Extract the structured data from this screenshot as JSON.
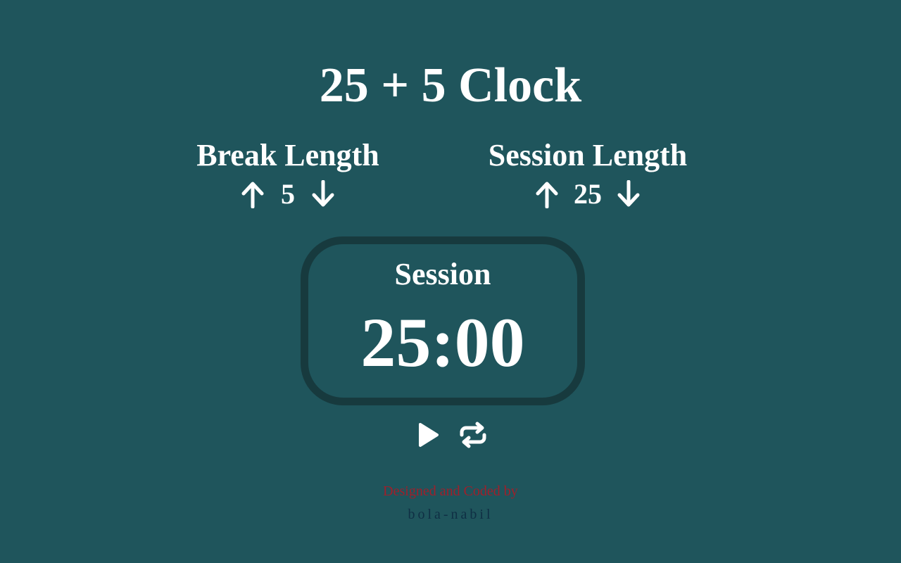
{
  "app": {
    "title": "25 + 5 Clock"
  },
  "break": {
    "label": "Break Length",
    "value": "5",
    "increment_icon": "arrow-up-icon",
    "decrement_icon": "arrow-down-icon"
  },
  "session": {
    "label": "Session Length",
    "value": "25",
    "increment_icon": "arrow-up-icon",
    "decrement_icon": "arrow-down-icon"
  },
  "timer": {
    "label": "Session",
    "time": "25:00"
  },
  "controls": {
    "play_icon": "play-icon",
    "reset_icon": "repeat-icon"
  },
  "footer": {
    "line1": "Designed and Coded by",
    "author": "bola-nabil"
  },
  "colors": {
    "background": "#1f555c",
    "timer_border": "#173a3e",
    "text": "#ffffff",
    "footer_line1": "#a01f2a",
    "footer_author": "#0f2f44"
  }
}
